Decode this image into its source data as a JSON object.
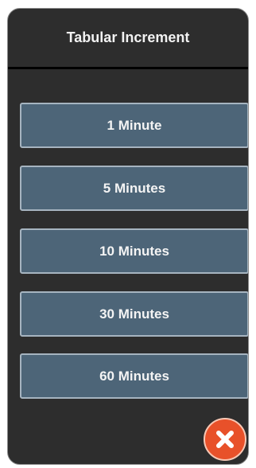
{
  "dialog": {
    "title": "Tabular Increment",
    "options": [
      {
        "label": "1 Minute"
      },
      {
        "label": "5 Minutes"
      },
      {
        "label": "10 Minutes"
      },
      {
        "label": "30 Minutes"
      },
      {
        "label": "60 Minutes"
      }
    ],
    "close_icon": "close-icon"
  },
  "colors": {
    "panel_bg": "#2d2d2d",
    "button_bg": "#4d6578",
    "button_border": "#a6b4c0",
    "close_bg": "#e8512a"
  }
}
